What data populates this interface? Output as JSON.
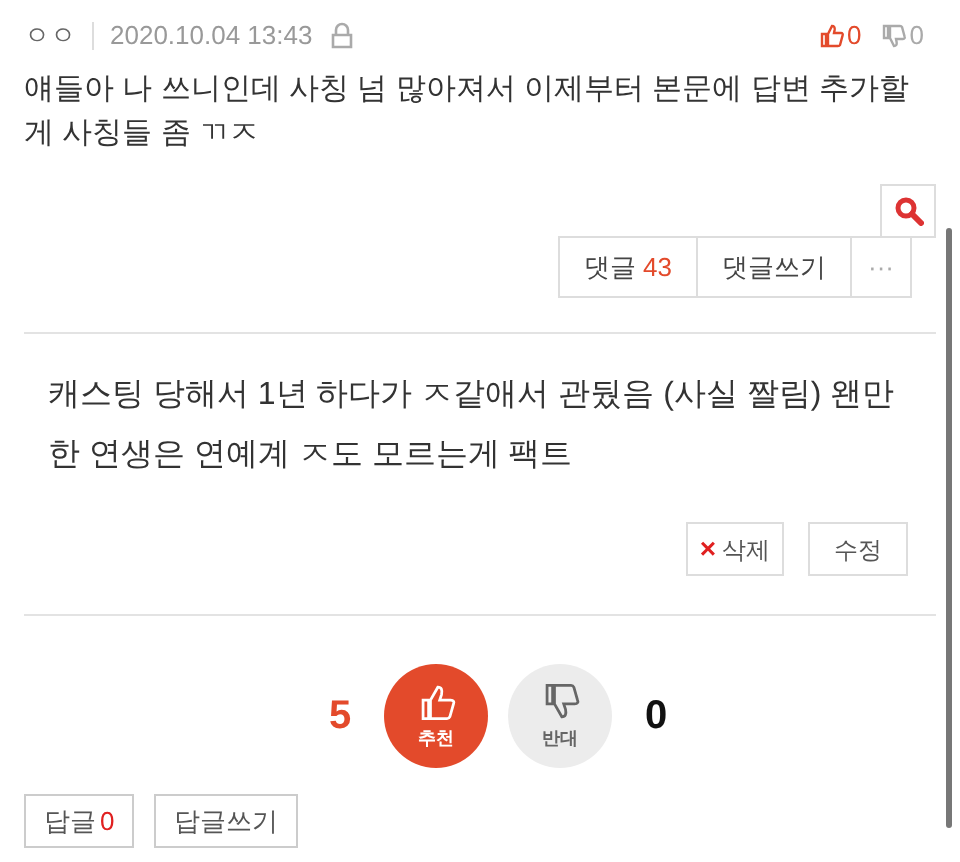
{
  "post": {
    "author": "ㅇㅇ",
    "date": "2020.10.04 13:43",
    "likes": "0",
    "dislikes": "0",
    "body": "얘들아 나 쓰니인데 사칭 넘 많아져서 이제부터 본문에 답변 추가할게 사칭들 좀 ㄲㅈ"
  },
  "comment_bar": {
    "comments_label": "댓글",
    "comments_count": "43",
    "write_label": "댓글쓰기",
    "more_label": "···"
  },
  "answer": {
    "body": "캐스팅 당해서 1년 하다가 ㅈ같애서 관뒀음 (사실 짤림) 왠만한 연생은 연예계 ㅈ도 모르는게 팩트",
    "delete_mark": "×",
    "delete_label": "삭제",
    "edit_label": "수정"
  },
  "votes": [
    {
      "kind": "up",
      "count": "5",
      "label": "추천",
      "selected": true
    },
    {
      "kind": "down",
      "count": "0",
      "label": "반대",
      "selected": false
    }
  ],
  "replies": {
    "label": "답글",
    "count": "0",
    "write_label": "답글쓰기"
  }
}
